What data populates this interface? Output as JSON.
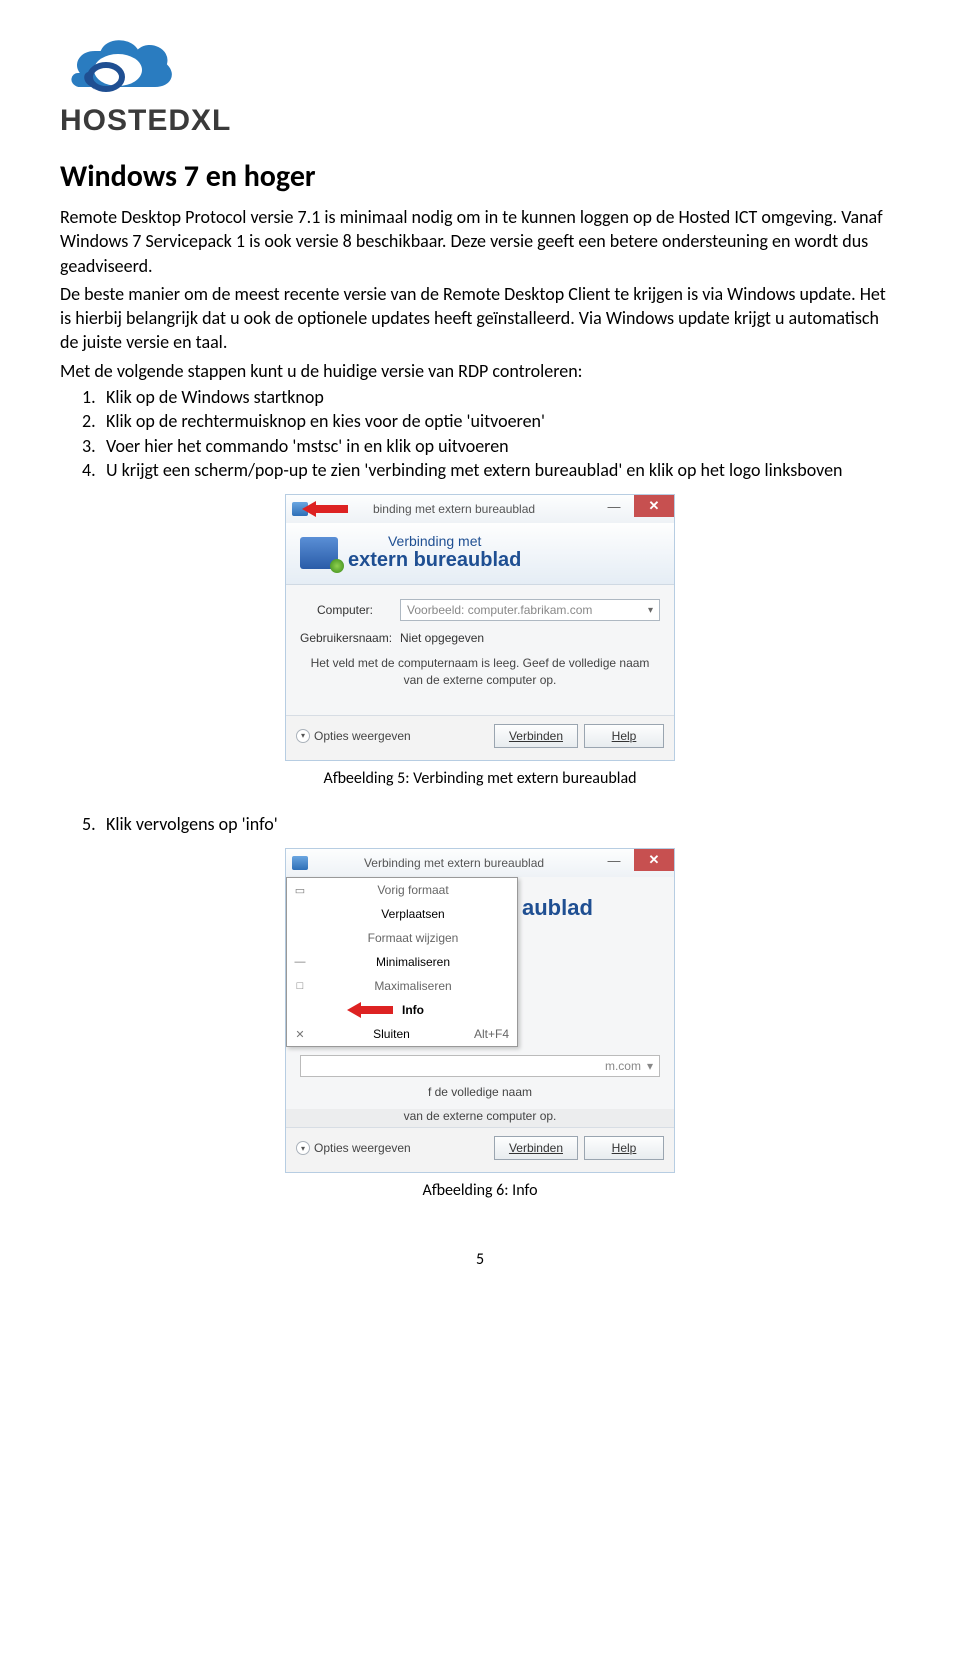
{
  "logo": {
    "text": "HOSTEDXL"
  },
  "heading": "Windows 7 en hoger",
  "paragraph": "Remote Desktop Protocol versie 7.1 is minimaal nodig om in te kunnen loggen op de Hosted ICT omgeving. Vanaf Windows 7 Servicepack 1 is ook versie 8 beschikbaar. Deze versie geeft een betere ondersteuning en wordt dus geadviseerd.",
  "paragraph2": "De beste manier om de meest recente versie van de Remote Desktop Client te krijgen is via Windows update. Het is hierbij belangrijk dat u ook de optionele updates heeft geïnstalleerd. Via Windows update krijgt u automatisch de juiste versie en taal.",
  "intro_list": "Met de volgende stappen kunt u de huidige versie van RDP controleren:",
  "steps": {
    "1": "Klik op de Windows startknop",
    "2": "Klik op de rechtermuisknop en kies voor de optie 'uitvoeren'",
    "3": "Voer hier het commando 'mstsc' in en klik op uitvoeren",
    "4": "U krijgt een scherm/pop-up te zien 'verbinding met extern bureaublad' en klik op het logo linksboven"
  },
  "fig1": {
    "caption": "Afbeelding 5: Verbinding met extern bureaublad",
    "titlebar": "binding met extern bureaublad",
    "header_line1": "Verbinding met",
    "header_line2": "extern bureaublad",
    "computer_label": "Computer:",
    "computer_placeholder": "Voorbeeld: computer.fabrikam.com",
    "user_label": "Gebruikersnaam:",
    "user_value": "Niet opgegeven",
    "msg_line1": "Het veld met de computernaam is leeg. Geef de volledige naam",
    "msg_line2": "van de externe computer op.",
    "options": "Opties weergeven",
    "btn_connect": "Verbinden",
    "btn_help": "Help"
  },
  "step5": "Klik vervolgens op 'info'",
  "fig2": {
    "caption": "Afbeelding 6: Info",
    "titlebar": "Verbinding met extern bureaublad",
    "menu": {
      "restore": "Vorig formaat",
      "move": "Verplaatsen",
      "size": "Formaat wijzigen",
      "min": "Minimaliseren",
      "max": "Maximaliseren",
      "info": "Info",
      "close": "Sluiten",
      "close_sc": "Alt+F4"
    },
    "header_partial": "aublad",
    "input_tail": "m.com",
    "msg_tail": "f de volledige naam",
    "compline": "van de externe computer op.",
    "options": "Opties weergeven",
    "btn_connect": "Verbinden",
    "btn_help": "Help"
  },
  "page_number": "5"
}
